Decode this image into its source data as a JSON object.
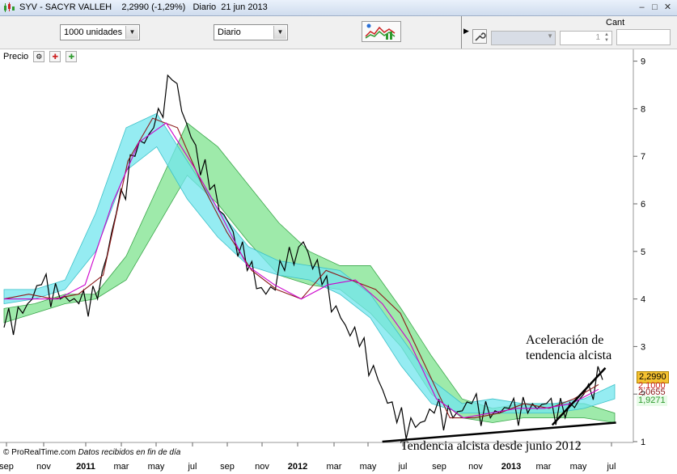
{
  "window": {
    "symbol": "SYV - SACYR VALLEH",
    "price": "2,2990",
    "change": "(-1,29%)",
    "period": "Diario",
    "date": "21 jun 2013",
    "min_glyph": "–",
    "max_glyph": "□",
    "close_glyph": "✕"
  },
  "toolbar": {
    "units_select": "1000 unidades",
    "period_select": "Diario",
    "cant_label": "Cant",
    "qty_value": "1"
  },
  "chart_header": {
    "label": "Precio"
  },
  "footer": {
    "source": "© ProRealTime.com",
    "note": "Datos recibidos en fin de día"
  },
  "annotations": {
    "accel_line1": "Aceleración de",
    "accel_line2": "tendencia alcista",
    "trend": "Tendencia alcista desde junio 2012"
  },
  "price_tags": {
    "current": "2,2990",
    "tag2": "2,1000",
    "tag3": "2,0655",
    "tag4": "1,9271"
  },
  "colors": {
    "price": "#000000",
    "fast_ma": "#8b1a1a",
    "slow_ma": "#cc00cc",
    "red_line": "#cc2222",
    "cloud_green": "#7de38d",
    "cloud_cyan": "#72e6ee",
    "trendline": "#000000",
    "current_tag_bg": "#f5c231"
  },
  "chart_data": {
    "type": "line",
    "x_tick_labels": [
      "sep",
      "nov",
      "2011",
      "mar",
      "may",
      "jul",
      "sep",
      "nov",
      "2012",
      "mar",
      "may",
      "jul",
      "sep",
      "nov",
      "2013",
      "mar",
      "may",
      "jul"
    ],
    "y_tick_labels": [
      "1",
      "2",
      "3",
      "4",
      "5",
      "6",
      "7",
      "8",
      "9"
    ],
    "ylim": [
      1,
      9
    ],
    "series": [
      {
        "values": [
          3.4,
          3.7,
          4.3,
          4.0,
          3.9,
          4.0,
          5.8,
          7.0,
          7.6,
          8.6,
          7.4,
          6.3,
          5.6,
          4.6,
          4.1,
          4.6,
          5.2,
          4.3,
          3.6,
          3.0,
          2.3,
          1.4,
          1.3,
          1.6,
          1.5,
          1.8,
          1.5,
          1.7,
          1.6,
          1.8,
          1.5,
          2.0,
          2.3
        ]
      },
      {
        "values": [
          4.0,
          4.1,
          4.0,
          4.1,
          4.5,
          6.9,
          7.8,
          7.6,
          6.4,
          5.4,
          4.6,
          4.2,
          4.0,
          4.6,
          4.4,
          4.2,
          3.7,
          2.6,
          1.5,
          1.5,
          1.6,
          1.8,
          1.7,
          1.9,
          2.2
        ]
      },
      {
        "values": [
          4.0,
          4.0,
          4.0,
          4.3,
          6.0,
          7.3,
          7.7,
          6.8,
          5.8,
          4.7,
          4.3,
          4.0,
          4.3,
          4.4,
          3.9,
          3.1,
          1.9,
          1.5,
          1.6,
          1.7,
          1.7,
          1.8,
          2.1
        ]
      }
    ],
    "clouds": [
      {
        "kind": "green",
        "upper": [
          3.8,
          3.9,
          4.1,
          4.1,
          4.9,
          6.3,
          7.7,
          7.2,
          6.4,
          5.6,
          5.0,
          4.7,
          4.7,
          3.8,
          2.8,
          1.9,
          1.7,
          1.8,
          1.8,
          1.8,
          1.6
        ],
        "lower": [
          3.5,
          3.7,
          3.9,
          4.0,
          4.4,
          5.5,
          6.6,
          6.0,
          5.2,
          4.5,
          4.3,
          4.2,
          3.7,
          3.0,
          2.0,
          1.5,
          1.4,
          1.5,
          1.5,
          1.5,
          1.4
        ]
      },
      {
        "kind": "cyan",
        "upper": [
          4.2,
          4.2,
          4.4,
          5.8,
          7.6,
          7.9,
          6.9,
          5.9,
          5.1,
          4.8,
          4.7,
          4.6,
          4.1,
          3.2,
          2.3,
          1.8,
          1.9,
          1.8,
          1.8,
          1.9,
          2.2
        ],
        "lower": [
          3.9,
          4.0,
          4.2,
          5.0,
          6.7,
          7.2,
          6.1,
          5.3,
          4.7,
          4.5,
          4.4,
          4.1,
          3.6,
          2.6,
          1.8,
          1.6,
          1.6,
          1.6,
          1.6,
          1.7,
          1.9
        ]
      }
    ],
    "trendlines": [
      {
        "from": [
          2012.45,
          1.0
        ],
        "to": [
          2013.55,
          1.4
        ]
      },
      {
        "from": [
          2013.25,
          1.35
        ],
        "to": [
          2013.5,
          2.55
        ]
      }
    ]
  }
}
